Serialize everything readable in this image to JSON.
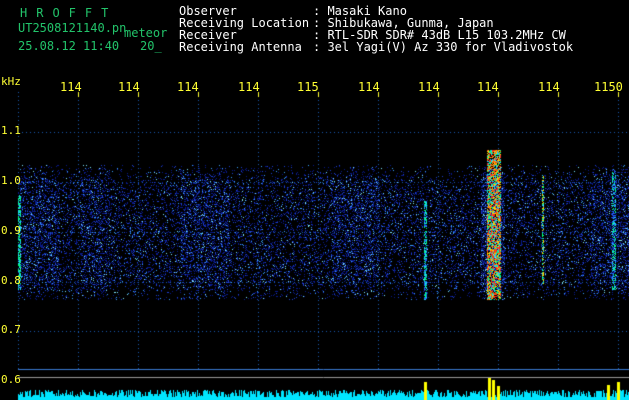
{
  "header": {
    "brand": "HROFFT",
    "filename": "UT2508121140.pn",
    "meteor_label": "meteor",
    "datetime": "25.08.12 11:40",
    "count": "20_",
    "fields": [
      {
        "label": "Observer",
        "value": ": Masaki Kano"
      },
      {
        "label": "Receiving Location",
        "value": ": Shibukawa, Gunma, Japan"
      },
      {
        "label": "Receiver",
        "value": ": RTL-SDR SDR# 43dB L15 103.2MHz CW"
      },
      {
        "label": "Receiving Antenna",
        "value": ": 3el Yagi(V) Az 330 for Vladivostok"
      }
    ]
  },
  "axes": {
    "y_unit": "kHz",
    "x_ticks": [
      "114",
      "114",
      "114",
      "114",
      "115",
      "114",
      "114",
      "114",
      "114",
      "1150"
    ],
    "y_ticks": [
      "1.1",
      "1.0",
      "0.9",
      "0.8",
      "0.7",
      "0.6"
    ]
  },
  "colors": {
    "background": "#000000",
    "grid": "#1a5bb5",
    "tick_text": "#ffff33",
    "brand": "#22c36a",
    "header_text": "#ffffff",
    "bottom_trace": "#00e5ff"
  }
}
